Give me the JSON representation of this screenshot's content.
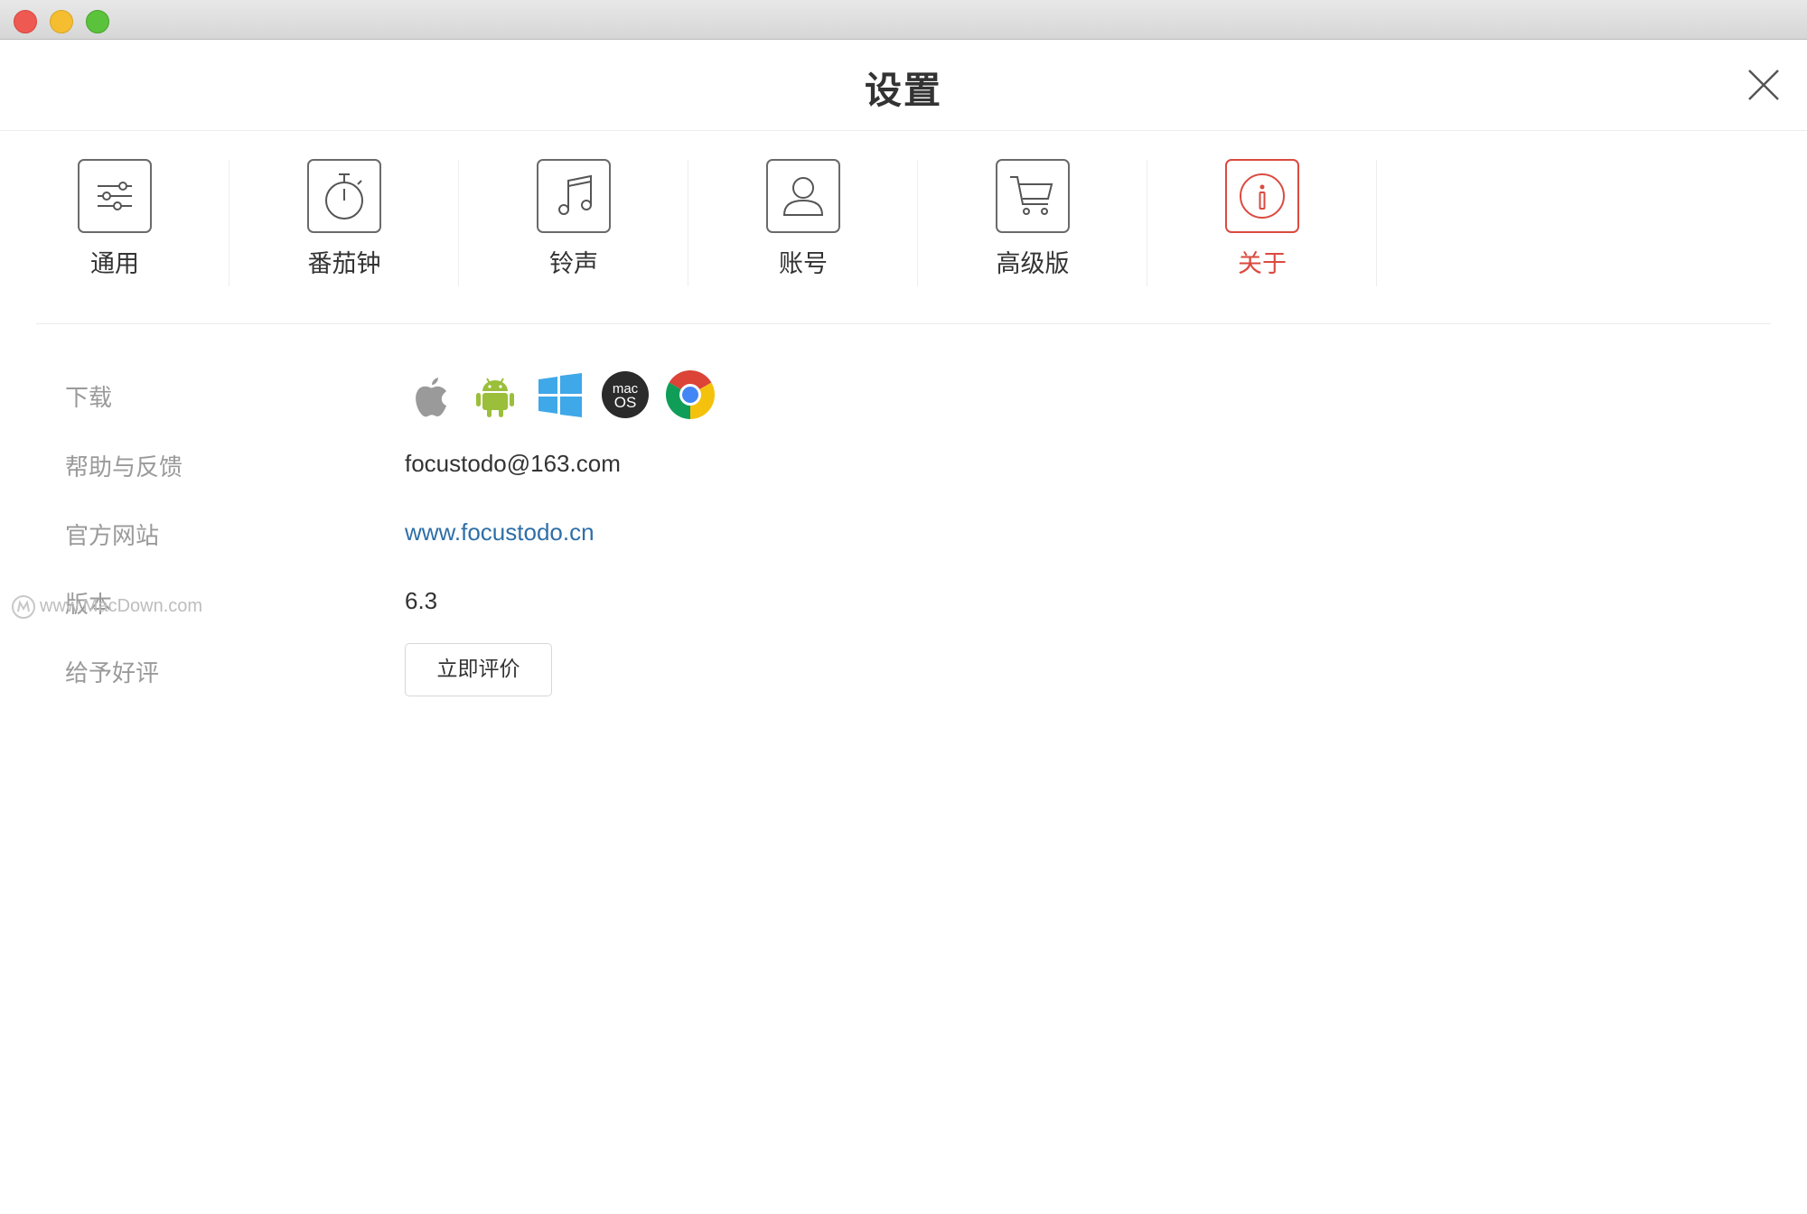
{
  "window": {
    "title": "设置"
  },
  "tabs": [
    {
      "label": "通用",
      "icon": "sliders-icon",
      "active": false
    },
    {
      "label": "番茄钟",
      "icon": "stopwatch-icon",
      "active": false
    },
    {
      "label": "铃声",
      "icon": "music-note-icon",
      "active": false
    },
    {
      "label": "账号",
      "icon": "user-icon",
      "active": false
    },
    {
      "label": "高级版",
      "icon": "cart-icon",
      "active": true
    },
    {
      "label": "关于",
      "icon": "info-icon",
      "active": true
    }
  ],
  "about": {
    "download_label": "下载",
    "download_platforms": [
      "apple-icon",
      "android-icon",
      "windows-icon",
      "macos-icon",
      "chrome-icon"
    ],
    "help_label": "帮助与反馈",
    "help_value": "focustodo@163.com",
    "website_label": "官方网站",
    "website_value": "www.focustodo.cn",
    "version_label": "版本",
    "version_value": "6.3",
    "rate_label": "给予好评",
    "rate_button": "立即评价"
  },
  "macos_badge": {
    "line1": "mac",
    "line2": "OS"
  },
  "watermark": "www.MacDown.com",
  "colors": {
    "accent": "#db4a3f",
    "link": "#2e6fa8",
    "android": "#9bbf3a",
    "windows": "#3fa8e8"
  }
}
